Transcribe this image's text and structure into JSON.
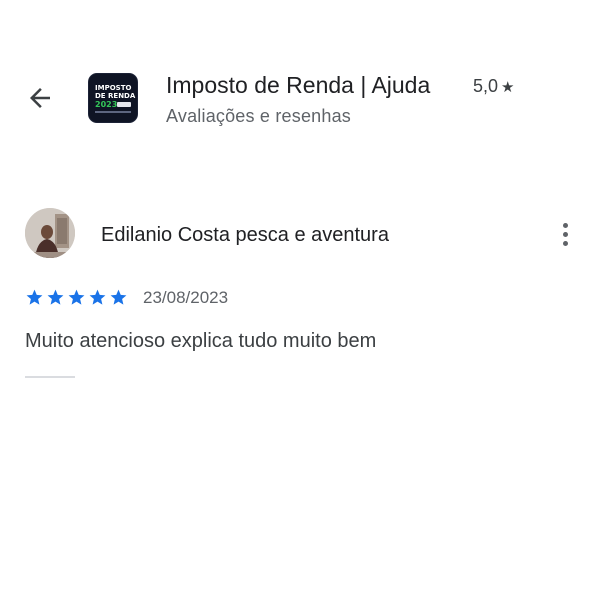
{
  "header": {
    "back_icon": "arrow-left-icon",
    "app_icon": {
      "line1": "IMPOSTO",
      "line2": "DE RENDA",
      "line3": "2023"
    },
    "title": "Imposto de Renda | Ajuda",
    "rating": "5,0",
    "rating_icon": "star-icon",
    "subtitle": "Avaliações e resenhas"
  },
  "review": {
    "reviewer_name": "Edilanio Costa pesca e aventura",
    "more_icon": "more-vert-icon",
    "star_count": 5,
    "star_color": "#1a73e8",
    "date": "23/08/2023",
    "text": "Muito atencioso explica tudo muito bem"
  }
}
